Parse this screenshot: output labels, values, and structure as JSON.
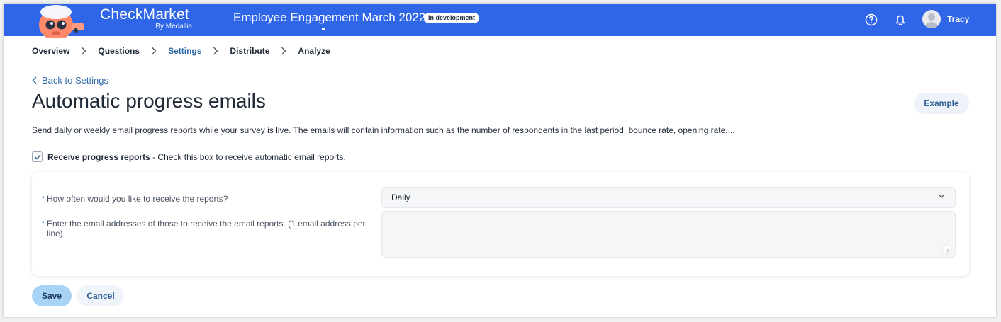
{
  "header": {
    "brand_name": "CheckMarket",
    "brand_sub": "By Medallia",
    "survey_title": "Employee Engagement March 2022",
    "status_badge": "In development",
    "user_name": "Tracy",
    "bar_color": "#2f66e8"
  },
  "breadcrumb": {
    "items": [
      {
        "label": "Overview",
        "active": false
      },
      {
        "label": "Questions",
        "active": false
      },
      {
        "label": "Settings",
        "active": true
      },
      {
        "label": "Distribute",
        "active": false
      },
      {
        "label": "Analyze",
        "active": false
      }
    ]
  },
  "page": {
    "back_link": "Back to Settings",
    "title": "Automatic progress emails",
    "example_button": "Example",
    "description": "Send daily or weekly email progress reports while your survey is live. The emails will contain information such as the number of respondents in the last period, bounce rate, opening rate,..."
  },
  "progress_reports": {
    "checked": true,
    "label_bold": "Receive progress reports",
    "label_rest": " - Check this box to receive automatic email reports."
  },
  "form": {
    "frequency_label": "How often would you like to receive the reports?",
    "frequency_value": "Daily",
    "emails_label_line1": "Enter the email addresses of those to receive the email reports. (1 email address per",
    "emails_label_line2": "line)",
    "emails_value": ""
  },
  "actions": {
    "save": "Save",
    "cancel": "Cancel"
  }
}
